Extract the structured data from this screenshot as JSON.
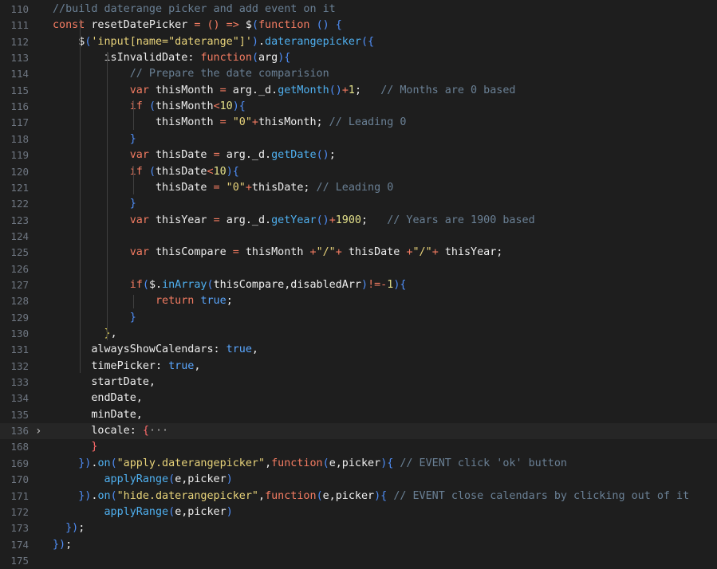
{
  "editor": {
    "lines": [
      {
        "num": "110",
        "tokens": [
          [
            "c",
            "//build daterange picker and add event on it"
          ]
        ]
      },
      {
        "num": "111",
        "tokens": [
          [
            "k",
            "const "
          ],
          [
            "i",
            "resetDatePicker "
          ],
          [
            "k",
            "= () => "
          ],
          [
            "i",
            "$"
          ],
          [
            "p",
            "("
          ],
          [
            "k",
            "function "
          ],
          [
            "p",
            "() {"
          ]
        ]
      },
      {
        "num": "112",
        "tokens": [
          [
            "i",
            "    $"
          ],
          [
            "p",
            "("
          ],
          [
            "s",
            "'input[name=\"daterange\"]'"
          ],
          [
            "p",
            ")"
          ],
          [
            "i",
            "."
          ],
          [
            "f",
            "daterangepicker"
          ],
          [
            "p",
            "({"
          ]
        ]
      },
      {
        "num": "113",
        "tokens": [
          [
            "i",
            "        isInvalidDate"
          ],
          [
            "i",
            ": "
          ],
          [
            "k",
            "function"
          ],
          [
            "p",
            "("
          ],
          [
            "i",
            "arg"
          ],
          [
            "p",
            "){"
          ]
        ]
      },
      {
        "num": "114",
        "tokens": [
          [
            "c",
            "            // Prepare the date comparision"
          ]
        ]
      },
      {
        "num": "115",
        "tokens": [
          [
            "k",
            "            var "
          ],
          [
            "i",
            "thisMonth "
          ],
          [
            "k",
            "= "
          ],
          [
            "i",
            "arg._d."
          ],
          [
            "f",
            "getMonth"
          ],
          [
            "p",
            "()"
          ],
          [
            "k",
            "+"
          ],
          [
            "n",
            "1"
          ],
          [
            "i",
            ";   "
          ],
          [
            "c",
            "// Months are 0 based"
          ]
        ]
      },
      {
        "num": "116",
        "tokens": [
          [
            "k",
            "            if "
          ],
          [
            "p",
            "("
          ],
          [
            "i",
            "thisMonth"
          ],
          [
            "k",
            "<"
          ],
          [
            "n",
            "10"
          ],
          [
            "p",
            "){"
          ]
        ]
      },
      {
        "num": "117",
        "tokens": [
          [
            "i",
            "                thisMonth "
          ],
          [
            "k",
            "= "
          ],
          [
            "s",
            "\"0\""
          ],
          [
            "k",
            "+"
          ],
          [
            "i",
            "thisMonth; "
          ],
          [
            "c",
            "// Leading 0"
          ]
        ]
      },
      {
        "num": "118",
        "tokens": [
          [
            "p",
            "            }"
          ]
        ]
      },
      {
        "num": "119",
        "tokens": [
          [
            "k",
            "            var "
          ],
          [
            "i",
            "thisDate "
          ],
          [
            "k",
            "= "
          ],
          [
            "i",
            "arg._d."
          ],
          [
            "f",
            "getDate"
          ],
          [
            "p",
            "()"
          ],
          [
            "i",
            ";"
          ]
        ]
      },
      {
        "num": "120",
        "tokens": [
          [
            "k",
            "            if "
          ],
          [
            "p",
            "("
          ],
          [
            "i",
            "thisDate"
          ],
          [
            "k",
            "<"
          ],
          [
            "n",
            "10"
          ],
          [
            "p",
            "){"
          ]
        ]
      },
      {
        "num": "121",
        "tokens": [
          [
            "i",
            "                thisDate "
          ],
          [
            "k",
            "= "
          ],
          [
            "s",
            "\"0\""
          ],
          [
            "k",
            "+"
          ],
          [
            "i",
            "thisDate; "
          ],
          [
            "c",
            "// Leading 0"
          ]
        ]
      },
      {
        "num": "122",
        "tokens": [
          [
            "p",
            "            }"
          ]
        ]
      },
      {
        "num": "123",
        "tokens": [
          [
            "k",
            "            var "
          ],
          [
            "i",
            "thisYear "
          ],
          [
            "k",
            "= "
          ],
          [
            "i",
            "arg._d."
          ],
          [
            "f",
            "getYear"
          ],
          [
            "p",
            "()"
          ],
          [
            "k",
            "+"
          ],
          [
            "n",
            "1900"
          ],
          [
            "i",
            ";   "
          ],
          [
            "c",
            "// Years are 1900 based"
          ]
        ]
      },
      {
        "num": "124",
        "tokens": []
      },
      {
        "num": "125",
        "tokens": [
          [
            "k",
            "            var "
          ],
          [
            "i",
            "thisCompare "
          ],
          [
            "k",
            "= "
          ],
          [
            "i",
            "thisMonth "
          ],
          [
            "k",
            "+"
          ],
          [
            "s",
            "\"/\""
          ],
          [
            "k",
            "+ "
          ],
          [
            "i",
            "thisDate "
          ],
          [
            "k",
            "+"
          ],
          [
            "s",
            "\"/\""
          ],
          [
            "k",
            "+ "
          ],
          [
            "i",
            "thisYear;"
          ]
        ]
      },
      {
        "num": "126",
        "tokens": []
      },
      {
        "num": "127",
        "tokens": [
          [
            "k",
            "            if"
          ],
          [
            "p",
            "("
          ],
          [
            "i",
            "$."
          ],
          [
            "f",
            "inArray"
          ],
          [
            "p",
            "("
          ],
          [
            "i",
            "thisCompare,disabledArr"
          ],
          [
            "p",
            ")"
          ],
          [
            "k",
            "!=-"
          ],
          [
            "n",
            "1"
          ],
          [
            "p",
            "){"
          ]
        ]
      },
      {
        "num": "128",
        "tokens": [
          [
            "k",
            "                return "
          ],
          [
            "bo",
            "true"
          ],
          [
            "i",
            ";"
          ]
        ]
      },
      {
        "num": "129",
        "tokens": [
          [
            "p",
            "            }"
          ]
        ]
      },
      {
        "num": "130",
        "tokens": [
          [
            "b",
            "        }"
          ],
          [
            "i",
            ","
          ]
        ]
      },
      {
        "num": "131",
        "tokens": [
          [
            "i",
            "      alwaysShowCalendars: "
          ],
          [
            "bo",
            "true"
          ],
          [
            "i",
            ","
          ]
        ]
      },
      {
        "num": "132",
        "tokens": [
          [
            "i",
            "      timePicker: "
          ],
          [
            "bo",
            "true"
          ],
          [
            "i",
            ","
          ]
        ]
      },
      {
        "num": "133",
        "tokens": [
          [
            "i",
            "      startDate,"
          ]
        ]
      },
      {
        "num": "134",
        "tokens": [
          [
            "i",
            "      endDate,"
          ]
        ]
      },
      {
        "num": "135",
        "tokens": [
          [
            "i",
            "      minDate,"
          ]
        ]
      },
      {
        "num": "136",
        "tokens": [
          [
            "i",
            "      locale: "
          ],
          [
            "o",
            "{"
          ],
          [
            "d",
            "···"
          ]
        ]
      },
      {
        "num": "168",
        "tokens": [
          [
            "o",
            "      }"
          ]
        ]
      },
      {
        "num": "169",
        "tokens": [
          [
            "p",
            "    })"
          ],
          [
            "i",
            "."
          ],
          [
            "f",
            "on"
          ],
          [
            "p",
            "("
          ],
          [
            "s",
            "\"apply.daterangepicker\""
          ],
          [
            "i",
            ","
          ],
          [
            "k",
            "function"
          ],
          [
            "p",
            "("
          ],
          [
            "i",
            "e,picker"
          ],
          [
            "p",
            "){ "
          ],
          [
            "c",
            "// EVENT click 'ok' button"
          ]
        ]
      },
      {
        "num": "170",
        "tokens": [
          [
            "f",
            "        applyRange"
          ],
          [
            "p",
            "("
          ],
          [
            "i",
            "e,picker"
          ],
          [
            "p",
            ")"
          ]
        ]
      },
      {
        "num": "171",
        "tokens": [
          [
            "p",
            "    })"
          ],
          [
            "i",
            "."
          ],
          [
            "f",
            "on"
          ],
          [
            "p",
            "("
          ],
          [
            "s",
            "\"hide.daterangepicker\""
          ],
          [
            "i",
            ","
          ],
          [
            "k",
            "function"
          ],
          [
            "p",
            "("
          ],
          [
            "i",
            "e,picker"
          ],
          [
            "p",
            "){ "
          ],
          [
            "c",
            "// EVENT close calendars by clicking out of it"
          ]
        ]
      },
      {
        "num": "172",
        "tokens": [
          [
            "f",
            "        applyRange"
          ],
          [
            "p",
            "("
          ],
          [
            "i",
            "e,picker"
          ],
          [
            "p",
            ")"
          ]
        ]
      },
      {
        "num": "173",
        "tokens": [
          [
            "p",
            "  })"
          ],
          [
            "i",
            ";"
          ]
        ]
      },
      {
        "num": "174",
        "tokens": [
          [
            "p",
            "})"
          ],
          [
            "i",
            ";"
          ]
        ]
      },
      {
        "num": "175",
        "tokens": []
      }
    ],
    "folded_line_marker": "›",
    "colors": {
      "background": "#1e1e1e",
      "comment": "#6a8095",
      "keyword": "#f47c62",
      "function": "#4fb0f0",
      "string": "#e8d37a",
      "number": "#e3e08a",
      "punctuation": "#4f8ef7",
      "boolean": "#5aa7ff"
    }
  }
}
